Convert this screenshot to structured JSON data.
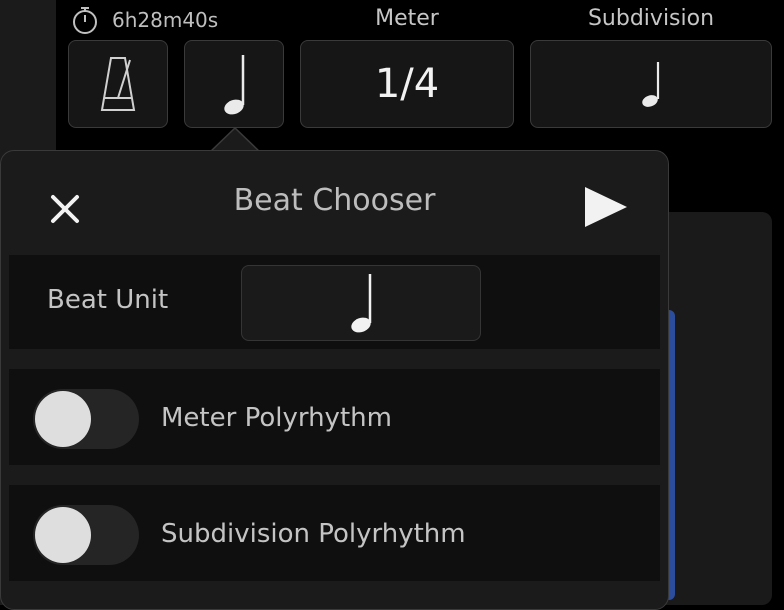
{
  "header": {
    "timer_value": "6h28m40s",
    "meter_label": "Meter",
    "subdivision_label": "Subdivision",
    "meter_value": "1/4"
  },
  "beat_chooser": {
    "title": "Beat Chooser",
    "beat_unit_label": "Beat Unit",
    "meter_polyrhythm_label": "Meter Polyrhythm",
    "subdivision_polyrhythm_label": "Subdivision Polyrhythm",
    "meter_polyrhythm_on": false,
    "subdivision_polyrhythm_on": false
  },
  "icons": {
    "timer": "stopwatch-icon",
    "metronome": "metronome-icon",
    "note": "quarter-note-icon",
    "close": "close-icon",
    "play": "play-icon"
  },
  "colors": {
    "background": "#000000",
    "panel": "#1b1b1b",
    "row": "#0f0f0f",
    "accent_blue": "#2c4c9c",
    "toggle_knob": "#dedede"
  }
}
